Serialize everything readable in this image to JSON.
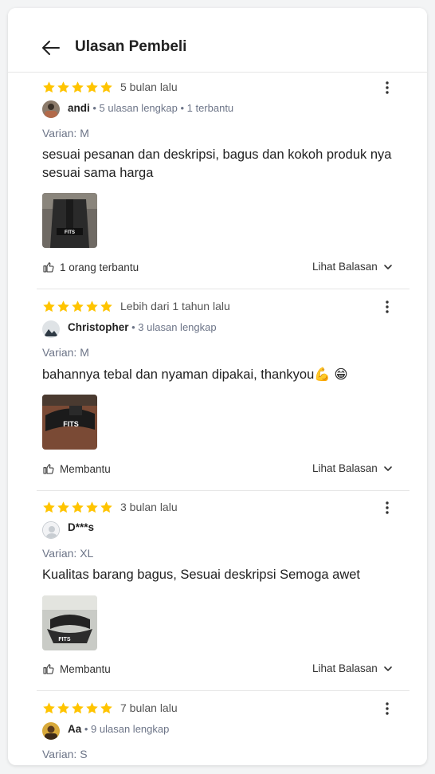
{
  "header": {
    "title": "Ulasan Pembeli"
  },
  "reviews": [
    {
      "rating": 5,
      "date": "5 bulan lalu",
      "user": "andi",
      "user_meta": " • 5 ulasan lengkap  •  1 terbantu",
      "variant": "Varian: M",
      "text": "sesuai pesanan dan deskripsi, bagus dan kokoh produk nya sesuai sama harga",
      "helpful": "1 orang terbantu",
      "reply": "Lihat Balasan"
    },
    {
      "rating": 5,
      "date": "Lebih dari 1 tahun lalu",
      "user": "Christopher",
      "user_meta": " • 3 ulasan lengkap",
      "variant": "Varian: M",
      "text": "bahannya tebal dan nyaman dipakai, thankyou💪 😁",
      "helpful": "Membantu",
      "reply": "Lihat Balasan"
    },
    {
      "rating": 5,
      "date": "3 bulan lalu",
      "user": "D***s",
      "user_meta": "",
      "variant": "Varian: XL",
      "text": "Kualitas barang bagus, Sesuai deskripsi Semoga awet",
      "helpful": "Membantu",
      "reply": "Lihat Balasan"
    },
    {
      "rating": 5,
      "date": "7 bulan lalu",
      "user": "Aa",
      "user_meta": " • 9 ulasan lengkap",
      "variant": "Varian: S"
    }
  ],
  "photo_label": "FITS",
  "colors": {
    "star": "#ffc400",
    "divider": "#e6e6e6",
    "text": "#212121",
    "muted": "#6d7588"
  }
}
